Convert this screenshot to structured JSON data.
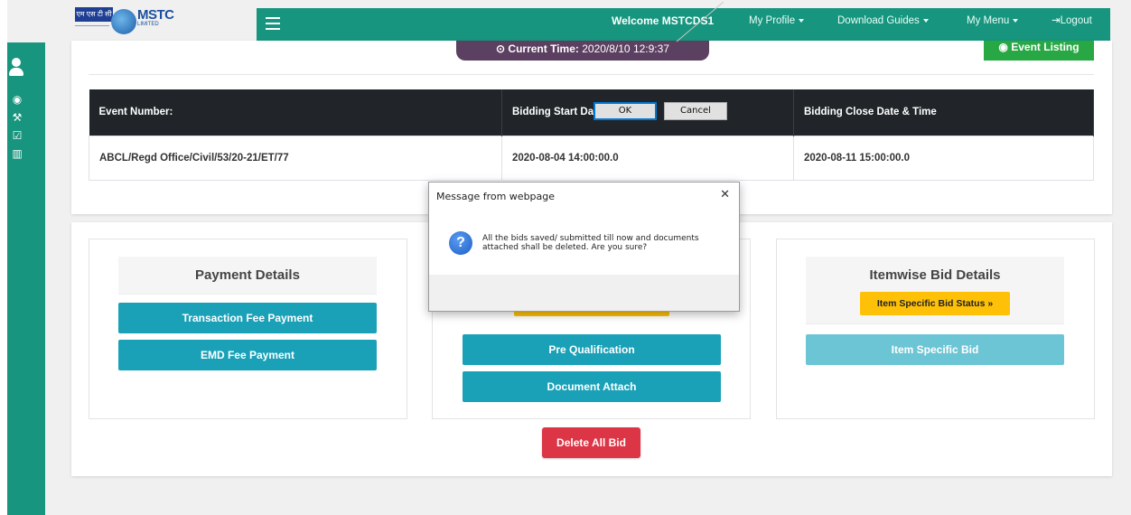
{
  "navbar": {
    "logo_text": "MSTC",
    "logo_sub": "LIMITED",
    "logo_hindi": "एम एस टी सी",
    "welcome": "Welcome MSTCDS1",
    "my_profile": "My Profile",
    "download_guides": "Download Guides",
    "my_menu": "My Menu",
    "logout": "Logout"
  },
  "header": {
    "current_time_label": "Current Time:",
    "current_time_value": "2020/8/10 12:9:37",
    "event_listing": "Event Listing"
  },
  "event_table": {
    "headers": [
      "Event Number:",
      "Bidding Start Date & Time",
      "Bidding Close Date & Time"
    ],
    "row": [
      "ABCL/Regd Office/Civil/53/20-21/ET/77",
      "2020-08-04 14:00:00.0",
      "2020-08-11 15:00:00.0"
    ]
  },
  "payment": {
    "title": "Payment Details",
    "transaction_fee": "Transaction Fee Payment",
    "emd_fee": "EMD Fee Payment"
  },
  "middle": {
    "pre_qualification": "Pre Qualification",
    "document_attach": "Document Attach"
  },
  "itemwise": {
    "title": "Itemwise Bid Details",
    "status_button": "Item Specific Bid Status »",
    "item_bid": "Item Specific Bid"
  },
  "delete_all": "Delete All Bid",
  "dialog": {
    "title": "Message from webpage",
    "message": "All the bids saved/ submitted till now and documents attached shall be deleted. Are you sure?",
    "ok": "OK",
    "cancel": "Cancel"
  },
  "colors": {
    "nav_green": "#17957e",
    "teal": "#1aa1b8",
    "yellow": "#ffc107",
    "red": "#dc3545",
    "dark_header": "#212529"
  }
}
